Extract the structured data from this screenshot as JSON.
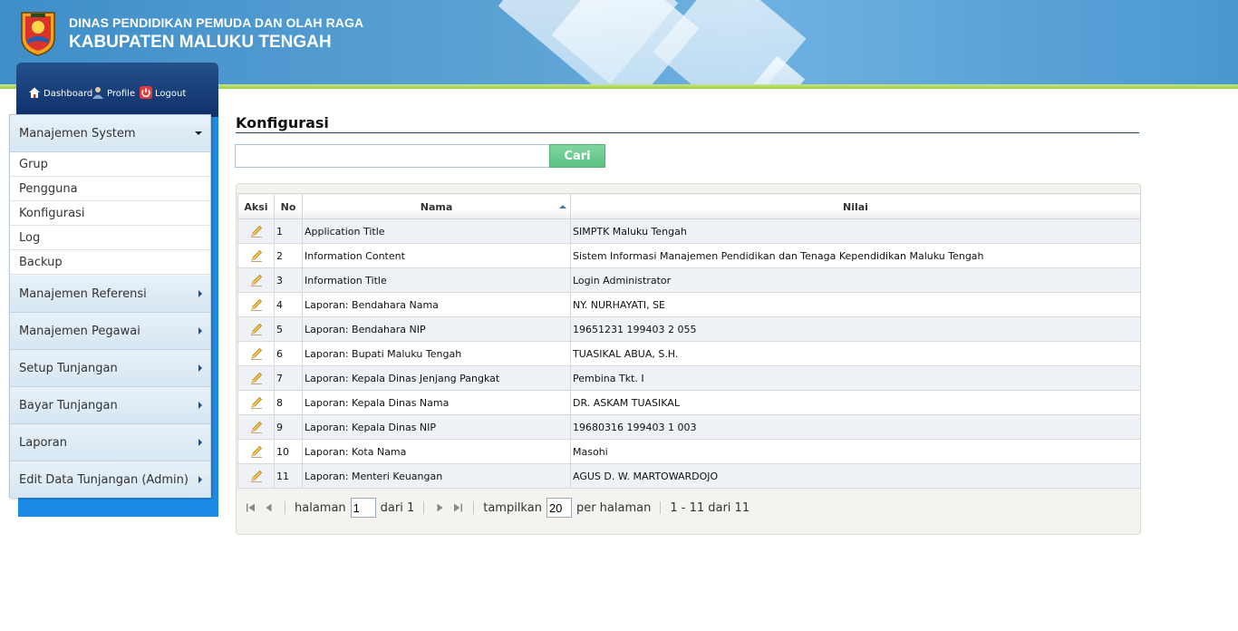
{
  "header": {
    "org_line": "DINAS PENDIDIKAN PEMUDA DAN OLAH RAGA",
    "region_line": "KABUPATEN MALUKU TENGAH"
  },
  "quick_links": {
    "dashboard": "Dashboard",
    "profile": "Profile",
    "logout": "Logout"
  },
  "menu": {
    "system": "Manajemen System",
    "system_items": [
      "Grup",
      "Pengguna",
      "Konfigurasi",
      "Log",
      "Backup"
    ],
    "sections": [
      "Manajemen Referensi",
      "Manajemen Pegawai",
      "Setup Tunjangan",
      "Bayar Tunjangan",
      "Laporan",
      "Edit Data Tunjangan (Admin)"
    ]
  },
  "page": {
    "title": "Konfigurasi",
    "search_value": "",
    "search_button": "Cari"
  },
  "table": {
    "headers": {
      "aksi": "Aksi",
      "no": "No",
      "nama": "Nama",
      "nilai": "Nilai"
    },
    "rows": [
      {
        "no": "1",
        "nama": "Application Title",
        "nilai": "SIMPTK Maluku Tengah"
      },
      {
        "no": "2",
        "nama": "Information Content",
        "nilai": "Sistem Informasi Manajemen Pendidikan dan Tenaga Kependidikan Maluku Tengah"
      },
      {
        "no": "3",
        "nama": "Information Title",
        "nilai": "Login Administrator"
      },
      {
        "no": "4",
        "nama": "Laporan: Bendahara Nama",
        "nilai": "NY. NURHAYATI, SE"
      },
      {
        "no": "5",
        "nama": "Laporan: Bendahara NIP",
        "nilai": "19651231 199403 2 055"
      },
      {
        "no": "6",
        "nama": "Laporan: Bupati Maluku Tengah",
        "nilai": "TUASIKAL ABUA, S.H."
      },
      {
        "no": "7",
        "nama": "Laporan: Kepala Dinas Jenjang Pangkat",
        "nilai": "Pembina Tkt. I"
      },
      {
        "no": "8",
        "nama": "Laporan: Kepala Dinas Nama",
        "nilai": "DR. ASKAM TUASIKAL"
      },
      {
        "no": "9",
        "nama": "Laporan: Kepala Dinas NIP",
        "nilai": "19680316 199403 1 003"
      },
      {
        "no": "10",
        "nama": "Laporan: Kota Nama",
        "nilai": "Masohi"
      },
      {
        "no": "11",
        "nama": "Laporan: Menteri Keuangan",
        "nilai": "AGUS D. W. MARTOWARDOJO"
      }
    ]
  },
  "pager": {
    "page_label": "halaman",
    "page_value": "1",
    "of_label": "dari 1",
    "show_label": "tampilkan",
    "per_page_value": "20",
    "per_page_label": "per halaman",
    "summary": "1 - 11 dari 11"
  },
  "colors": {
    "header_blue": "#5ea4d6",
    "sidebar_blue": "#1d8be6",
    "accent_green": "#5cc282",
    "title_rule": "#233d5a"
  }
}
